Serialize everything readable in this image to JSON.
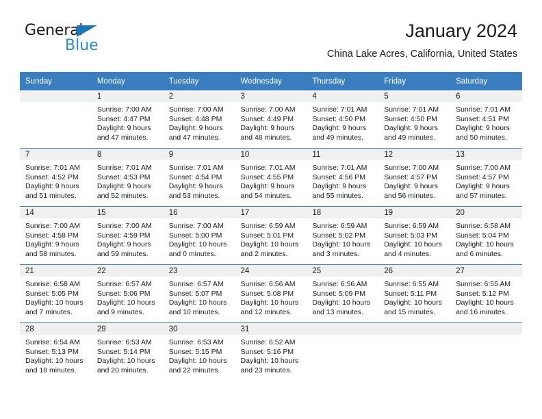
{
  "brand": {
    "word1": "General",
    "word2": "Blue",
    "flag_icon": "triangle-flag-icon",
    "accent_dark": "#1b75bb",
    "accent_light": "#2b8ccc"
  },
  "header": {
    "title": "January 2024",
    "subtitle": "China Lake Acres, California, United States"
  },
  "theme": {
    "header_blue": "#3a7ebf",
    "daynum_band": "#f0f0f0",
    "text": "#1a1a1a"
  },
  "weekday_headers": [
    "Sunday",
    "Monday",
    "Tuesday",
    "Wednesday",
    "Thursday",
    "Friday",
    "Saturday"
  ],
  "weeks": [
    [
      {
        "day": "",
        "sunrise": "",
        "sunset": "",
        "daylight1": "",
        "daylight2": ""
      },
      {
        "day": "1",
        "sunrise": "Sunrise: 7:00 AM",
        "sunset": "Sunset: 4:47 PM",
        "daylight1": "Daylight: 9 hours",
        "daylight2": "and 47 minutes."
      },
      {
        "day": "2",
        "sunrise": "Sunrise: 7:00 AM",
        "sunset": "Sunset: 4:48 PM",
        "daylight1": "Daylight: 9 hours",
        "daylight2": "and 47 minutes."
      },
      {
        "day": "3",
        "sunrise": "Sunrise: 7:00 AM",
        "sunset": "Sunset: 4:49 PM",
        "daylight1": "Daylight: 9 hours",
        "daylight2": "and 48 minutes."
      },
      {
        "day": "4",
        "sunrise": "Sunrise: 7:01 AM",
        "sunset": "Sunset: 4:50 PM",
        "daylight1": "Daylight: 9 hours",
        "daylight2": "and 49 minutes."
      },
      {
        "day": "5",
        "sunrise": "Sunrise: 7:01 AM",
        "sunset": "Sunset: 4:50 PM",
        "daylight1": "Daylight: 9 hours",
        "daylight2": "and 49 minutes."
      },
      {
        "day": "6",
        "sunrise": "Sunrise: 7:01 AM",
        "sunset": "Sunset: 4:51 PM",
        "daylight1": "Daylight: 9 hours",
        "daylight2": "and 50 minutes."
      }
    ],
    [
      {
        "day": "7",
        "sunrise": "Sunrise: 7:01 AM",
        "sunset": "Sunset: 4:52 PM",
        "daylight1": "Daylight: 9 hours",
        "daylight2": "and 51 minutes."
      },
      {
        "day": "8",
        "sunrise": "Sunrise: 7:01 AM",
        "sunset": "Sunset: 4:53 PM",
        "daylight1": "Daylight: 9 hours",
        "daylight2": "and 52 minutes."
      },
      {
        "day": "9",
        "sunrise": "Sunrise: 7:01 AM",
        "sunset": "Sunset: 4:54 PM",
        "daylight1": "Daylight: 9 hours",
        "daylight2": "and 53 minutes."
      },
      {
        "day": "10",
        "sunrise": "Sunrise: 7:01 AM",
        "sunset": "Sunset: 4:55 PM",
        "daylight1": "Daylight: 9 hours",
        "daylight2": "and 54 minutes."
      },
      {
        "day": "11",
        "sunrise": "Sunrise: 7:01 AM",
        "sunset": "Sunset: 4:56 PM",
        "daylight1": "Daylight: 9 hours",
        "daylight2": "and 55 minutes."
      },
      {
        "day": "12",
        "sunrise": "Sunrise: 7:00 AM",
        "sunset": "Sunset: 4:57 PM",
        "daylight1": "Daylight: 9 hours",
        "daylight2": "and 56 minutes."
      },
      {
        "day": "13",
        "sunrise": "Sunrise: 7:00 AM",
        "sunset": "Sunset: 4:57 PM",
        "daylight1": "Daylight: 9 hours",
        "daylight2": "and 57 minutes."
      }
    ],
    [
      {
        "day": "14",
        "sunrise": "Sunrise: 7:00 AM",
        "sunset": "Sunset: 4:58 PM",
        "daylight1": "Daylight: 9 hours",
        "daylight2": "and 58 minutes."
      },
      {
        "day": "15",
        "sunrise": "Sunrise: 7:00 AM",
        "sunset": "Sunset: 4:59 PM",
        "daylight1": "Daylight: 9 hours",
        "daylight2": "and 59 minutes."
      },
      {
        "day": "16",
        "sunrise": "Sunrise: 7:00 AM",
        "sunset": "Sunset: 5:00 PM",
        "daylight1": "Daylight: 10 hours",
        "daylight2": "and 0 minutes."
      },
      {
        "day": "17",
        "sunrise": "Sunrise: 6:59 AM",
        "sunset": "Sunset: 5:01 PM",
        "daylight1": "Daylight: 10 hours",
        "daylight2": "and 2 minutes."
      },
      {
        "day": "18",
        "sunrise": "Sunrise: 6:59 AM",
        "sunset": "Sunset: 5:02 PM",
        "daylight1": "Daylight: 10 hours",
        "daylight2": "and 3 minutes."
      },
      {
        "day": "19",
        "sunrise": "Sunrise: 6:59 AM",
        "sunset": "Sunset: 5:03 PM",
        "daylight1": "Daylight: 10 hours",
        "daylight2": "and 4 minutes."
      },
      {
        "day": "20",
        "sunrise": "Sunrise: 6:58 AM",
        "sunset": "Sunset: 5:04 PM",
        "daylight1": "Daylight: 10 hours",
        "daylight2": "and 6 minutes."
      }
    ],
    [
      {
        "day": "21",
        "sunrise": "Sunrise: 6:58 AM",
        "sunset": "Sunset: 5:05 PM",
        "daylight1": "Daylight: 10 hours",
        "daylight2": "and 7 minutes."
      },
      {
        "day": "22",
        "sunrise": "Sunrise: 6:57 AM",
        "sunset": "Sunset: 5:06 PM",
        "daylight1": "Daylight: 10 hours",
        "daylight2": "and 9 minutes."
      },
      {
        "day": "23",
        "sunrise": "Sunrise: 6:57 AM",
        "sunset": "Sunset: 5:07 PM",
        "daylight1": "Daylight: 10 hours",
        "daylight2": "and 10 minutes."
      },
      {
        "day": "24",
        "sunrise": "Sunrise: 6:56 AM",
        "sunset": "Sunset: 5:08 PM",
        "daylight1": "Daylight: 10 hours",
        "daylight2": "and 12 minutes."
      },
      {
        "day": "25",
        "sunrise": "Sunrise: 6:56 AM",
        "sunset": "Sunset: 5:09 PM",
        "daylight1": "Daylight: 10 hours",
        "daylight2": "and 13 minutes."
      },
      {
        "day": "26",
        "sunrise": "Sunrise: 6:55 AM",
        "sunset": "Sunset: 5:11 PM",
        "daylight1": "Daylight: 10 hours",
        "daylight2": "and 15 minutes."
      },
      {
        "day": "27",
        "sunrise": "Sunrise: 6:55 AM",
        "sunset": "Sunset: 5:12 PM",
        "daylight1": "Daylight: 10 hours",
        "daylight2": "and 16 minutes."
      }
    ],
    [
      {
        "day": "28",
        "sunrise": "Sunrise: 6:54 AM",
        "sunset": "Sunset: 5:13 PM",
        "daylight1": "Daylight: 10 hours",
        "daylight2": "and 18 minutes."
      },
      {
        "day": "29",
        "sunrise": "Sunrise: 6:53 AM",
        "sunset": "Sunset: 5:14 PM",
        "daylight1": "Daylight: 10 hours",
        "daylight2": "and 20 minutes."
      },
      {
        "day": "30",
        "sunrise": "Sunrise: 6:53 AM",
        "sunset": "Sunset: 5:15 PM",
        "daylight1": "Daylight: 10 hours",
        "daylight2": "and 22 minutes."
      },
      {
        "day": "31",
        "sunrise": "Sunrise: 6:52 AM",
        "sunset": "Sunset: 5:16 PM",
        "daylight1": "Daylight: 10 hours",
        "daylight2": "and 23 minutes."
      },
      {
        "day": "",
        "sunrise": "",
        "sunset": "",
        "daylight1": "",
        "daylight2": ""
      },
      {
        "day": "",
        "sunrise": "",
        "sunset": "",
        "daylight1": "",
        "daylight2": ""
      },
      {
        "day": "",
        "sunrise": "",
        "sunset": "",
        "daylight1": "",
        "daylight2": ""
      }
    ]
  ]
}
